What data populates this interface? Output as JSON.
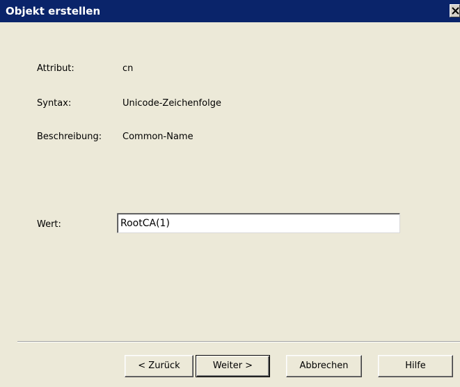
{
  "window": {
    "title": "Objekt erstellen",
    "close_icon": "close-x-icon"
  },
  "details": {
    "attribute_label": "Attribut:",
    "attribute_value": "cn",
    "syntax_label": "Syntax:",
    "syntax_value": "Unicode-Zeichenfolge",
    "description_label": "Beschreibung:",
    "description_value": "Common-Name"
  },
  "value_field": {
    "label": "Wert:",
    "value": "RootCA(1)"
  },
  "buttons": {
    "back": "< Zurück",
    "next": "Weiter >",
    "cancel": "Abbrechen",
    "help": "Hilfe"
  },
  "colors": {
    "titlebar": "#0a246a",
    "dialog_background": "#ece9d8"
  }
}
